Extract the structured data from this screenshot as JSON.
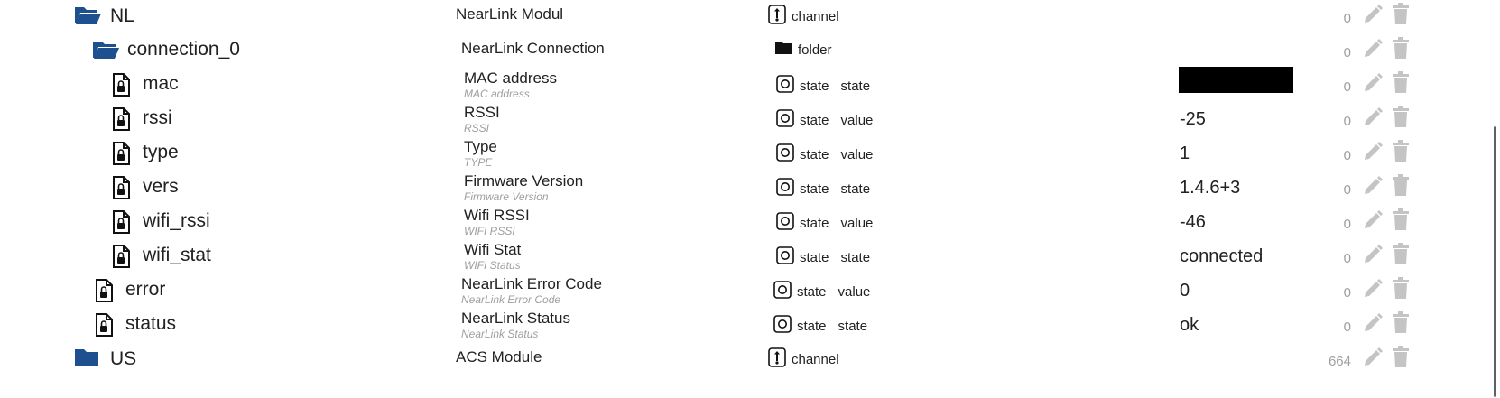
{
  "colors": {
    "folder": "#1e4f8e",
    "text": "#212121",
    "muted": "#9e9e9e",
    "action": "#c4c4c4"
  },
  "rows": [
    {
      "key": "nl",
      "icon": "folder-open-icon",
      "name": "NL",
      "desc": "NearLink Modul",
      "subdesc": "",
      "type_icon": "channel-icon",
      "type": "channel",
      "role": "",
      "value": "",
      "count": "0"
    },
    {
      "key": "connection_0",
      "icon": "folder-open-icon",
      "name": "connection_0",
      "desc": "NearLink Connection",
      "subdesc": "",
      "type_icon": "folder-icon",
      "type": "folder",
      "role": "",
      "value": "",
      "count": "0"
    },
    {
      "key": "mac",
      "icon": "file-lock-icon",
      "name": "mac",
      "desc": "MAC address",
      "subdesc": "MAC address",
      "type_icon": "state-icon",
      "type": "state",
      "role": "state",
      "value": "",
      "count": "0"
    },
    {
      "key": "rssi",
      "icon": "file-lock-icon",
      "name": "rssi",
      "desc": "RSSI",
      "subdesc": "RSSI",
      "type_icon": "state-icon",
      "type": "state",
      "role": "value",
      "value": "-25",
      "count": "0"
    },
    {
      "key": "type",
      "icon": "file-lock-icon",
      "name": "type",
      "desc": "Type",
      "subdesc": "TYPE",
      "type_icon": "state-icon",
      "type": "state",
      "role": "value",
      "value": "1",
      "count": "0"
    },
    {
      "key": "vers",
      "icon": "file-lock-icon",
      "name": "vers",
      "desc": "Firmware Version",
      "subdesc": "Firmware Version",
      "type_icon": "state-icon",
      "type": "state",
      "role": "state",
      "value": "1.4.6+3",
      "count": "0"
    },
    {
      "key": "wifi_rssi",
      "icon": "file-lock-icon",
      "name": "wifi_rssi",
      "desc": "Wifi RSSI",
      "subdesc": "WIFI RSSI",
      "type_icon": "state-icon",
      "type": "state",
      "role": "value",
      "value": "-46",
      "count": "0"
    },
    {
      "key": "wifi_stat",
      "icon": "file-lock-icon",
      "name": "wifi_stat",
      "desc": "Wifi Stat",
      "subdesc": "WIFI Status",
      "type_icon": "state-icon",
      "type": "state",
      "role": "state",
      "value": "connected",
      "count": "0"
    },
    {
      "key": "error",
      "icon": "file-lock-icon",
      "name": "error",
      "desc": "NearLink Error Code",
      "subdesc": "NearLink Error Code",
      "type_icon": "state-icon",
      "type": "state",
      "role": "value",
      "value": "0",
      "count": "0"
    },
    {
      "key": "status",
      "icon": "file-lock-icon",
      "name": "status",
      "desc": "NearLink Status",
      "subdesc": "NearLink Status",
      "type_icon": "state-icon",
      "type": "state",
      "role": "state",
      "value": "ok",
      "count": "0"
    },
    {
      "key": "us",
      "icon": "folder-closed-icon",
      "name": "US",
      "desc": "ACS Module",
      "subdesc": "",
      "type_icon": "channel-icon",
      "type": "channel",
      "role": "",
      "value": "",
      "count": "664"
    }
  ]
}
